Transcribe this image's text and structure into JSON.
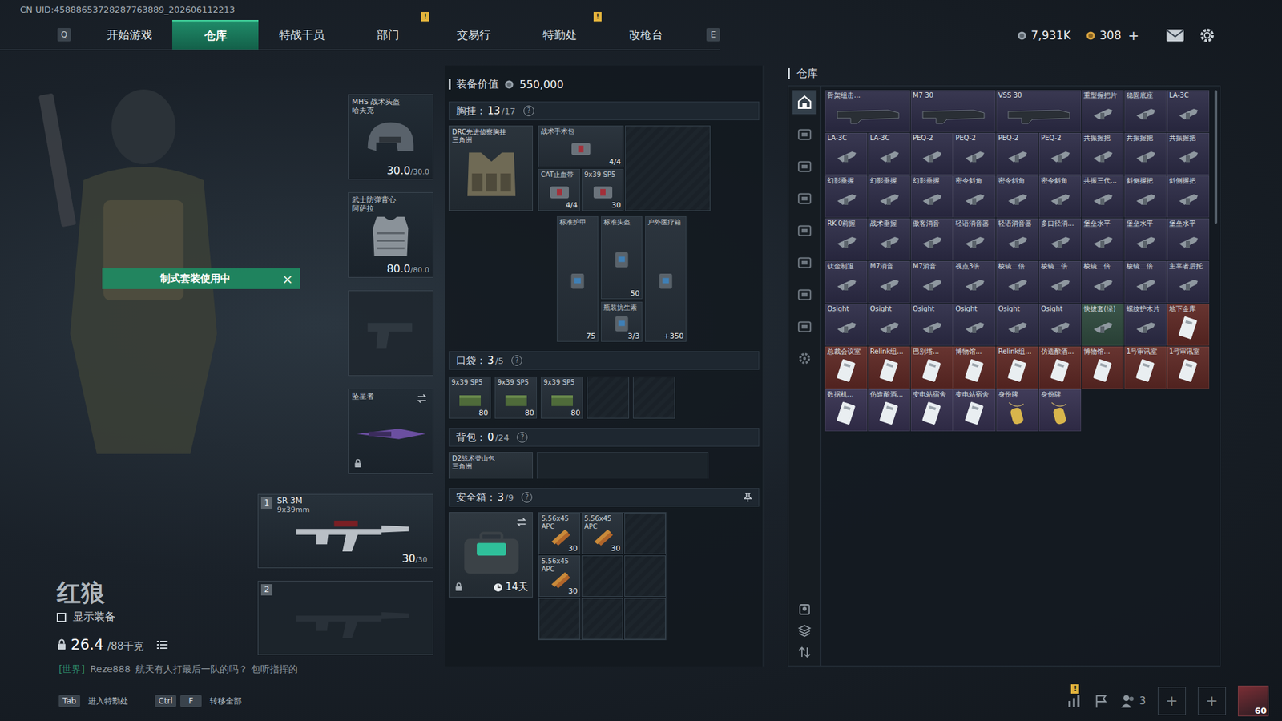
{
  "uid": "CN UID:45888653728287763889_202606112213",
  "nav": {
    "key_left": "Q",
    "key_right": "E",
    "tabs": [
      {
        "label": "开始游戏",
        "selected": false,
        "badge": null
      },
      {
        "label": "仓库",
        "selected": true,
        "badge": null
      },
      {
        "label": "特战干员",
        "selected": false,
        "badge": null
      },
      {
        "label": "部门",
        "selected": false,
        "badge": "!"
      },
      {
        "label": "交易行",
        "selected": false,
        "badge": null
      },
      {
        "label": "特勤处",
        "selected": false,
        "badge": "!"
      },
      {
        "label": "改枪台",
        "selected": false,
        "badge": null
      }
    ]
  },
  "currency": {
    "coins": "7,931K",
    "tickets": "308",
    "add": "+"
  },
  "operator": {
    "name": "红狼",
    "outfit_badge": "制式套装使用中",
    "outfit_close": "×",
    "show_gear_label": "显示装备",
    "show_gear_checked": false,
    "weight": "26.4",
    "weight_max": "/88千克"
  },
  "chat": {
    "channel": "[世界]",
    "sender": "Reze888",
    "message": "航天有人打最后一队的吗？ 包听指挥的"
  },
  "gear": {
    "helmet": {
      "name": "MHS 战术头盔",
      "brand": "哈夫克",
      "durability": "30.0",
      "max": "/30.0"
    },
    "armor": {
      "name": "武士防弹背心",
      "brand": "阿萨拉",
      "durability": "80.0",
      "max": "/80.0"
    },
    "pistol": {
      "empty": true
    },
    "melee": {
      "name": "坠星者",
      "locked": true
    },
    "weapons": [
      {
        "slot": "1",
        "empty": false,
        "name": "SR-3M",
        "caliber": "9x39mm",
        "ammo": "30",
        "ammo_max": "/30"
      },
      {
        "slot": "2",
        "empty": true,
        "name": "",
        "caliber": "",
        "ammo": "",
        "ammo_max": ""
      }
    ]
  },
  "loadout": {
    "value_label": "装备价值",
    "value": "550,000",
    "help": "?",
    "chest": {
      "label": "胸挂：",
      "count": "13",
      "capacity": "/17",
      "rig_name": "DRC先进侦察胸挂",
      "rig_brand": "三角洲",
      "items": [
        {
          "name": "战术手术包",
          "count": "4/4"
        },
        {
          "name": "CAT止血带",
          "count": "4/4"
        },
        {
          "name": "9x39 SP5",
          "count": "30"
        },
        {
          "name": "标准护甲",
          "count": "75"
        },
        {
          "name": "标准头盔",
          "count": "50"
        },
        {
          "name": "瓶装抗生素",
          "count": "3/3"
        },
        {
          "name": "户外医疗箱",
          "count": "+350"
        }
      ]
    },
    "pocket": {
      "label": "口袋：",
      "count": "3",
      "capacity": "/5",
      "slots": [
        {
          "empty": false,
          "name": "9x39 SP5",
          "count": "80"
        },
        {
          "empty": false,
          "name": "9x39 SP5",
          "count": "80"
        },
        {
          "empty": false,
          "name": "9x39 SP5",
          "count": "80"
        },
        {
          "empty": true,
          "name": "",
          "count": ""
        },
        {
          "empty": true,
          "name": "",
          "count": ""
        }
      ]
    },
    "backpack": {
      "label": "背包：",
      "count": "0",
      "capacity": "/24",
      "bag_name": "D2战术登山包",
      "bag_brand": "三角洲"
    },
    "safebox": {
      "label": "安全箱：",
      "count": "3",
      "capacity": "/9",
      "timer": "14天",
      "locked": true,
      "slots": [
        {
          "empty": false,
          "name": "5.56x45 APC",
          "count": "30"
        },
        {
          "empty": false,
          "name": "5.56x45 APC",
          "count": "30"
        },
        {
          "empty": true,
          "name": "",
          "count": ""
        },
        {
          "empty": false,
          "name": "5.56x45 APC",
          "count": "30"
        },
        {
          "empty": true,
          "name": "",
          "count": ""
        },
        {
          "empty": true,
          "name": "",
          "count": ""
        },
        {
          "empty": true,
          "name": "",
          "count": ""
        },
        {
          "empty": true,
          "name": "",
          "count": ""
        },
        {
          "empty": true,
          "name": "",
          "count": ""
        }
      ]
    }
  },
  "warehouse": {
    "title": "仓库",
    "tabs": [
      {
        "selected": true
      },
      {
        "selected": false
      },
      {
        "selected": false
      },
      {
        "selected": false
      },
      {
        "selected": false
      },
      {
        "selected": false
      },
      {
        "selected": false
      },
      {
        "selected": false
      },
      {
        "selected": false
      }
    ],
    "items": [
      {
        "name": "骨架组击...",
        "kind": "wide",
        "color": "#2d2c47"
      },
      {
        "name": "M7 30",
        "kind": "wide",
        "color": "#2d2c47"
      },
      {
        "name": "VSS 30",
        "kind": "wide",
        "color": "#2d2c47"
      },
      {
        "name": "重型握把片",
        "kind": "part",
        "color": "#2d2c47"
      },
      {
        "name": "稳固底座",
        "kind": "part",
        "color": "#2d2c47"
      },
      {
        "name": "LA-3C",
        "kind": "part",
        "color": "#2d2c47"
      },
      {
        "name": "LA-3C",
        "kind": "part",
        "color": "#2d2c47"
      },
      {
        "name": "LA-3C",
        "kind": "part",
        "color": "#2d2c47"
      },
      {
        "name": "PEQ-2",
        "kind": "part",
        "color": "#2d2c47"
      },
      {
        "name": "PEQ-2",
        "kind": "part",
        "color": "#2d2c47"
      },
      {
        "name": "PEQ-2",
        "kind": "part",
        "color": "#2d2c47"
      },
      {
        "name": "PEQ-2",
        "kind": "part",
        "color": "#2d2c47"
      },
      {
        "name": "共振握把",
        "kind": "part",
        "color": "#2d2c47"
      },
      {
        "name": "共振握把",
        "kind": "part",
        "color": "#2d2c47"
      },
      {
        "name": "共振握把",
        "kind": "part",
        "color": "#2d2c47"
      },
      {
        "name": "幻影垂握",
        "kind": "part",
        "color": "#2d2c47"
      },
      {
        "name": "幻影垂握",
        "kind": "part",
        "color": "#2d2c47"
      },
      {
        "name": "幻影垂握",
        "kind": "part",
        "color": "#2d2c47"
      },
      {
        "name": "密令斜角",
        "kind": "part",
        "color": "#2d2c47"
      },
      {
        "name": "密令斜角",
        "kind": "part",
        "color": "#2d2c47"
      },
      {
        "name": "密令斜角",
        "kind": "part",
        "color": "#2d2c47"
      },
      {
        "name": "共振三代...",
        "kind": "part",
        "color": "#2d2c47"
      },
      {
        "name": "斜侧握把",
        "kind": "part",
        "color": "#2d2c47"
      },
      {
        "name": "斜侧握把",
        "kind": "part",
        "color": "#2d2c47"
      },
      {
        "name": "RK-0前握",
        "kind": "part",
        "color": "#2d2c47"
      },
      {
        "name": "战术垂握",
        "kind": "part",
        "color": "#2d2c47"
      },
      {
        "name": "傲客消音",
        "kind": "part",
        "color": "#2d2c47"
      },
      {
        "name": "轻语消音器",
        "kind": "part",
        "color": "#2d2c47"
      },
      {
        "name": "轻语消音器",
        "kind": "part",
        "color": "#2d2c47"
      },
      {
        "name": "多口径消...",
        "kind": "part",
        "color": "#2d2c47"
      },
      {
        "name": "堡垒水平",
        "kind": "part",
        "color": "#2d2c47"
      },
      {
        "name": "堡垒水平",
        "kind": "part",
        "color": "#2d2c47"
      },
      {
        "name": "堡垒水平",
        "kind": "part",
        "color": "#2d2c47"
      },
      {
        "name": "钛金制退",
        "kind": "part",
        "color": "#2d2c47"
      },
      {
        "name": "M7消音",
        "kind": "part",
        "color": "#2d2c47"
      },
      {
        "name": "M7消音",
        "kind": "part",
        "color": "#2d2c47"
      },
      {
        "name": "视点3倍",
        "kind": "part",
        "color": "#2d2c47"
      },
      {
        "name": "棱镜二倍",
        "kind": "part",
        "color": "#2d2c47"
      },
      {
        "name": "棱镜二倍",
        "kind": "part",
        "color": "#2d2c47"
      },
      {
        "name": "棱镜二倍",
        "kind": "part",
        "color": "#2d2c47"
      },
      {
        "name": "棱镜二倍",
        "kind": "part",
        "color": "#2d2c47"
      },
      {
        "name": "主宰者后托",
        "kind": "part",
        "color": "#2d2c47"
      },
      {
        "name": "Osight",
        "kind": "part",
        "color": "#2d2c47"
      },
      {
        "name": "Osight",
        "kind": "part",
        "color": "#2d2c47"
      },
      {
        "name": "Osight",
        "kind": "part",
        "color": "#2d2c47"
      },
      {
        "name": "Osight",
        "kind": "part",
        "color": "#2d2c47"
      },
      {
        "name": "Osight",
        "kind": "part",
        "color": "#2d2c47"
      },
      {
        "name": "Osight",
        "kind": "part",
        "color": "#2d2c47"
      },
      {
        "name": "快拔套(绿)",
        "kind": "part",
        "color": "#2f4a3e"
      },
      {
        "name": "螺纹护木片",
        "kind": "part",
        "color": "#2d2c47"
      },
      {
        "name": "地下金库",
        "kind": "card",
        "color": "#5e2824"
      },
      {
        "name": "总裁会议室",
        "kind": "card",
        "color": "#5e2824"
      },
      {
        "name": "Relink组...",
        "kind": "card",
        "color": "#5e2824"
      },
      {
        "name": "巴别塔...",
        "kind": "card",
        "color": "#5e2824"
      },
      {
        "name": "博物馆...",
        "kind": "card",
        "color": "#5e2824"
      },
      {
        "name": "Relink组...",
        "kind": "card",
        "color": "#5e2824"
      },
      {
        "name": "仿造酿酒...",
        "kind": "card",
        "color": "#5e2824"
      },
      {
        "name": "博物馆...",
        "kind": "card",
        "color": "#5e2824"
      },
      {
        "name": "1号审讯室",
        "kind": "card",
        "color": "#5e2824"
      },
      {
        "name": "1号审讯室",
        "kind": "card",
        "color": "#5e2824"
      },
      {
        "name": "数据机...",
        "kind": "card",
        "color": "#35304f"
      },
      {
        "name": "仿造酿酒...",
        "kind": "card",
        "color": "#35304f"
      },
      {
        "name": "变电站宿舍",
        "kind": "card",
        "color": "#35304f"
      },
      {
        "name": "变电站宿舍",
        "kind": "card",
        "color": "#35304f"
      },
      {
        "name": "身份牌",
        "kind": "tag",
        "color": "#35304f"
      },
      {
        "name": "身份牌",
        "kind": "tag",
        "color": "#35304f"
      }
    ]
  },
  "bottom": {
    "hints": [
      {
        "keys": [
          "Tab"
        ],
        "label": "进入特勤处"
      },
      {
        "keys": [
          "Ctrl",
          "F"
        ],
        "label": "转移全部"
      }
    ],
    "stats_badge": "!",
    "squad_count": "3",
    "add_slots": [
      "+",
      "+"
    ],
    "level": "60"
  }
}
